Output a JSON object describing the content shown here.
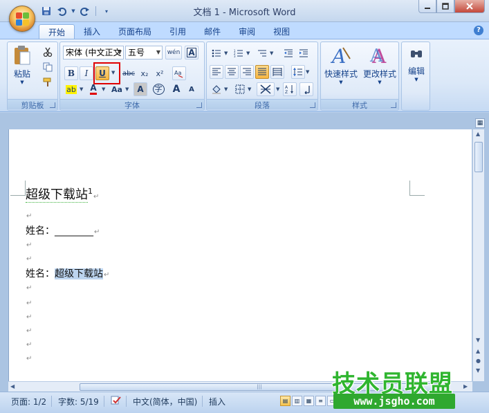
{
  "window": {
    "title": "文档 1 - Microsoft Word"
  },
  "qat": {
    "save_icon": "save-icon",
    "undo_icon": "undo-icon",
    "redo_icon": "redo-icon"
  },
  "tabs": [
    {
      "label": "开始",
      "active": true
    },
    {
      "label": "插入"
    },
    {
      "label": "页面布局"
    },
    {
      "label": "引用"
    },
    {
      "label": "邮件"
    },
    {
      "label": "审阅"
    },
    {
      "label": "视图"
    }
  ],
  "ribbon": {
    "clipboard": {
      "paste_label": "粘贴",
      "group_label": "剪贴板"
    },
    "font": {
      "font_name": "宋体 (中文正文",
      "font_size": "五号",
      "group_label": "字体",
      "bold": "B",
      "italic": "I",
      "underline": "U",
      "strike": "abc",
      "subscript": "x₂",
      "superscript": "x²",
      "highlight": "ab",
      "font_color": "A",
      "change_case": "Aa",
      "char_shading": "A",
      "enclose": "字",
      "grow": "A",
      "shrink": "A",
      "wen": "wén",
      "border": "A"
    },
    "paragraph": {
      "group_label": "段落"
    },
    "styles": {
      "quick_styles": "快速样式",
      "change_styles": "更改样式",
      "group_label": "样式"
    },
    "editing": {
      "label": "编辑"
    }
  },
  "document": {
    "lines": [
      {
        "text": "超级下载站",
        "sup": "1"
      },
      {
        "text": ""
      },
      {
        "text": "姓名：",
        "blank": "________"
      },
      {
        "text": ""
      },
      {
        "text": ""
      },
      {
        "text": "姓名：",
        "selected": "超级下载站"
      },
      {
        "text": ""
      },
      {
        "text": ""
      },
      {
        "text": ""
      },
      {
        "text": ""
      },
      {
        "text": ""
      },
      {
        "text": ""
      }
    ],
    "pilcrow": "↵"
  },
  "status": {
    "page": "页面: 1/2",
    "words": "字数: 5/19",
    "language": "中文(简体，中国)",
    "mode": "插入"
  },
  "watermark": {
    "title": "技术员联盟",
    "url": "www.jsgho.com"
  },
  "colors": {
    "accent": "#2b579a",
    "highlight_box": "#e00000",
    "watermark_green": "#2fb52f"
  }
}
